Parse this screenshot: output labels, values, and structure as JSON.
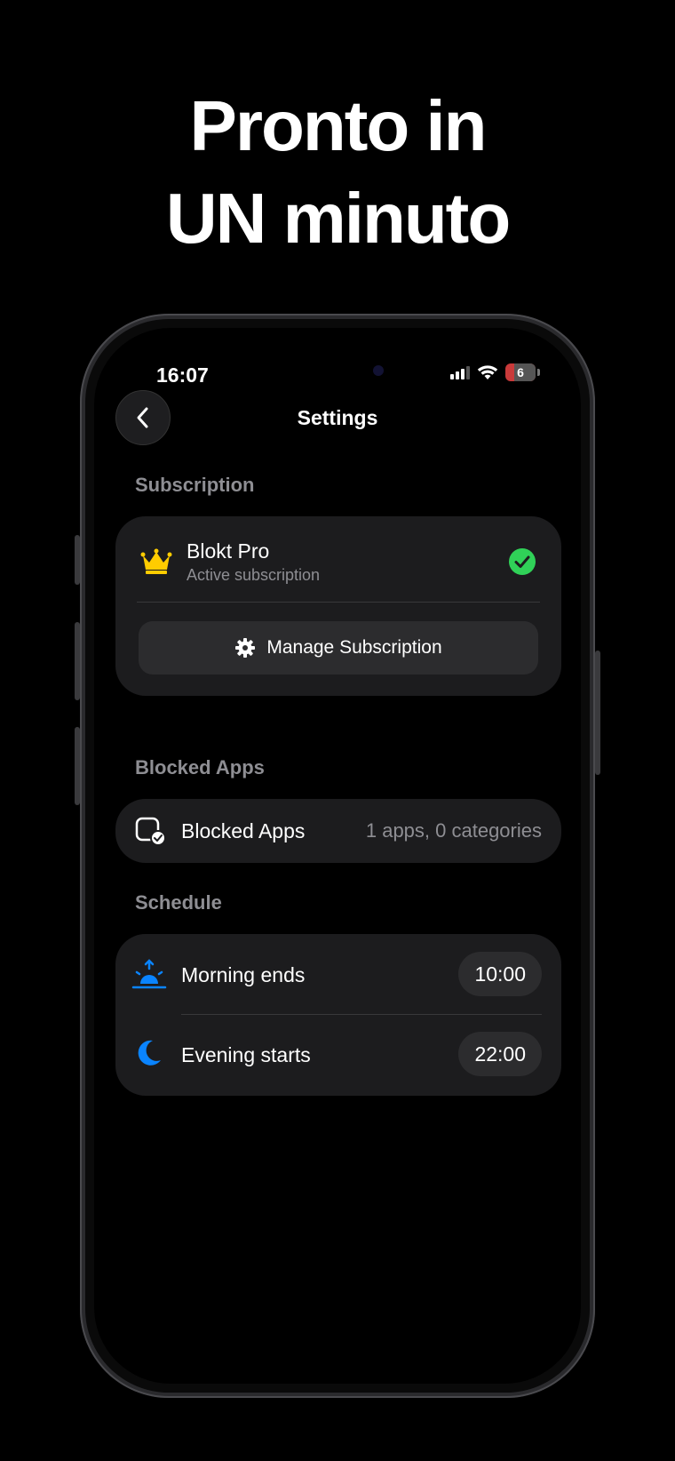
{
  "headline": {
    "line1": "Pronto in",
    "line2": "UN minuto"
  },
  "status_bar": {
    "time": "16:07",
    "battery": "6"
  },
  "nav": {
    "title": "Settings"
  },
  "subscription": {
    "section_label": "Subscription",
    "plan_name": "Blokt Pro",
    "plan_status": "Active subscription",
    "manage_label": "Manage Subscription"
  },
  "blocked_apps": {
    "section_label": "Blocked Apps",
    "row_label": "Blocked Apps",
    "row_value": "1 apps, 0 categories"
  },
  "schedule": {
    "section_label": "Schedule",
    "items": [
      {
        "label": "Morning ends",
        "value": "10:00",
        "icon": "sunrise-icon"
      },
      {
        "label": "Evening starts",
        "value": "22:00",
        "icon": "moon-icon"
      }
    ]
  },
  "colors": {
    "background": "#000000",
    "card": "#1c1c1e",
    "accent_blue": "#0a84ff",
    "check_green": "#30d158",
    "crown_gold": "#ffcc00"
  }
}
